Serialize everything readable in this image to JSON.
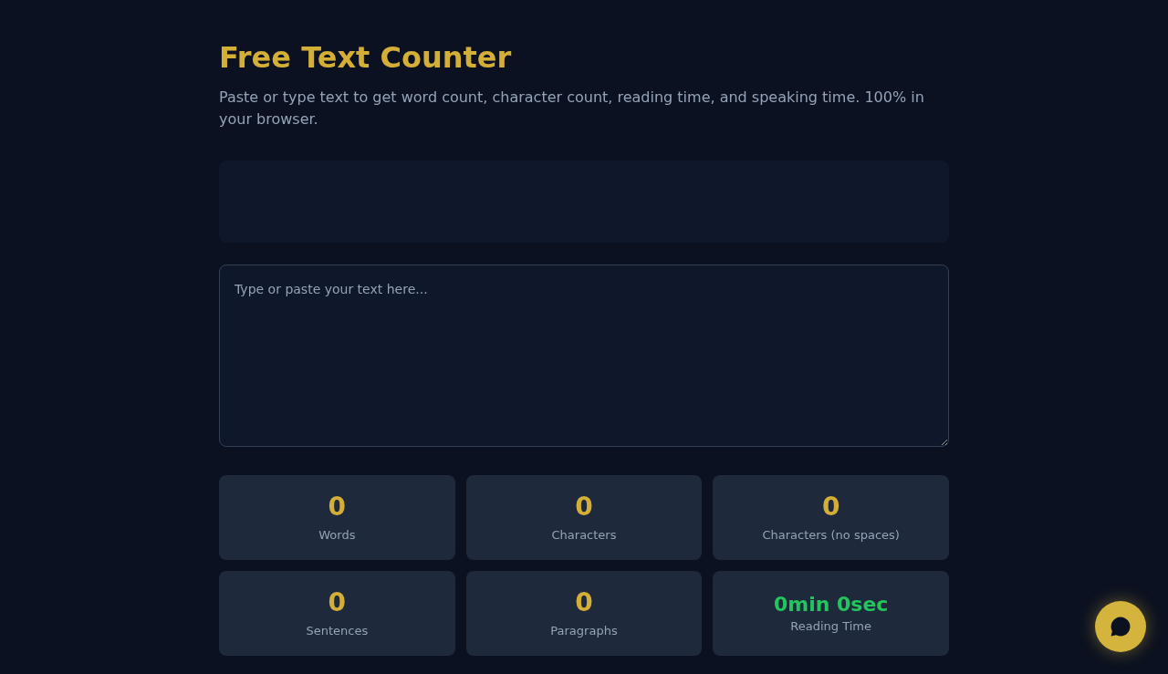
{
  "header": {
    "title": "Free Text Counter",
    "subtitle": "Paste or type text to get word count, character count, reading time, and speaking time. 100% in your browser."
  },
  "text_input": {
    "placeholder": "Type or paste your text here..."
  },
  "stats": [
    {
      "kind": "count",
      "value": "0",
      "label": "Words"
    },
    {
      "kind": "count",
      "value": "0",
      "label": "Characters"
    },
    {
      "kind": "count",
      "value": "0",
      "label": "Characters (no spaces)"
    },
    {
      "kind": "count",
      "value": "0",
      "label": "Sentences"
    },
    {
      "kind": "count",
      "value": "0",
      "label": "Paragraphs"
    },
    {
      "kind": "time",
      "value": "0min 0sec",
      "label": "Reading Time"
    }
  ]
}
